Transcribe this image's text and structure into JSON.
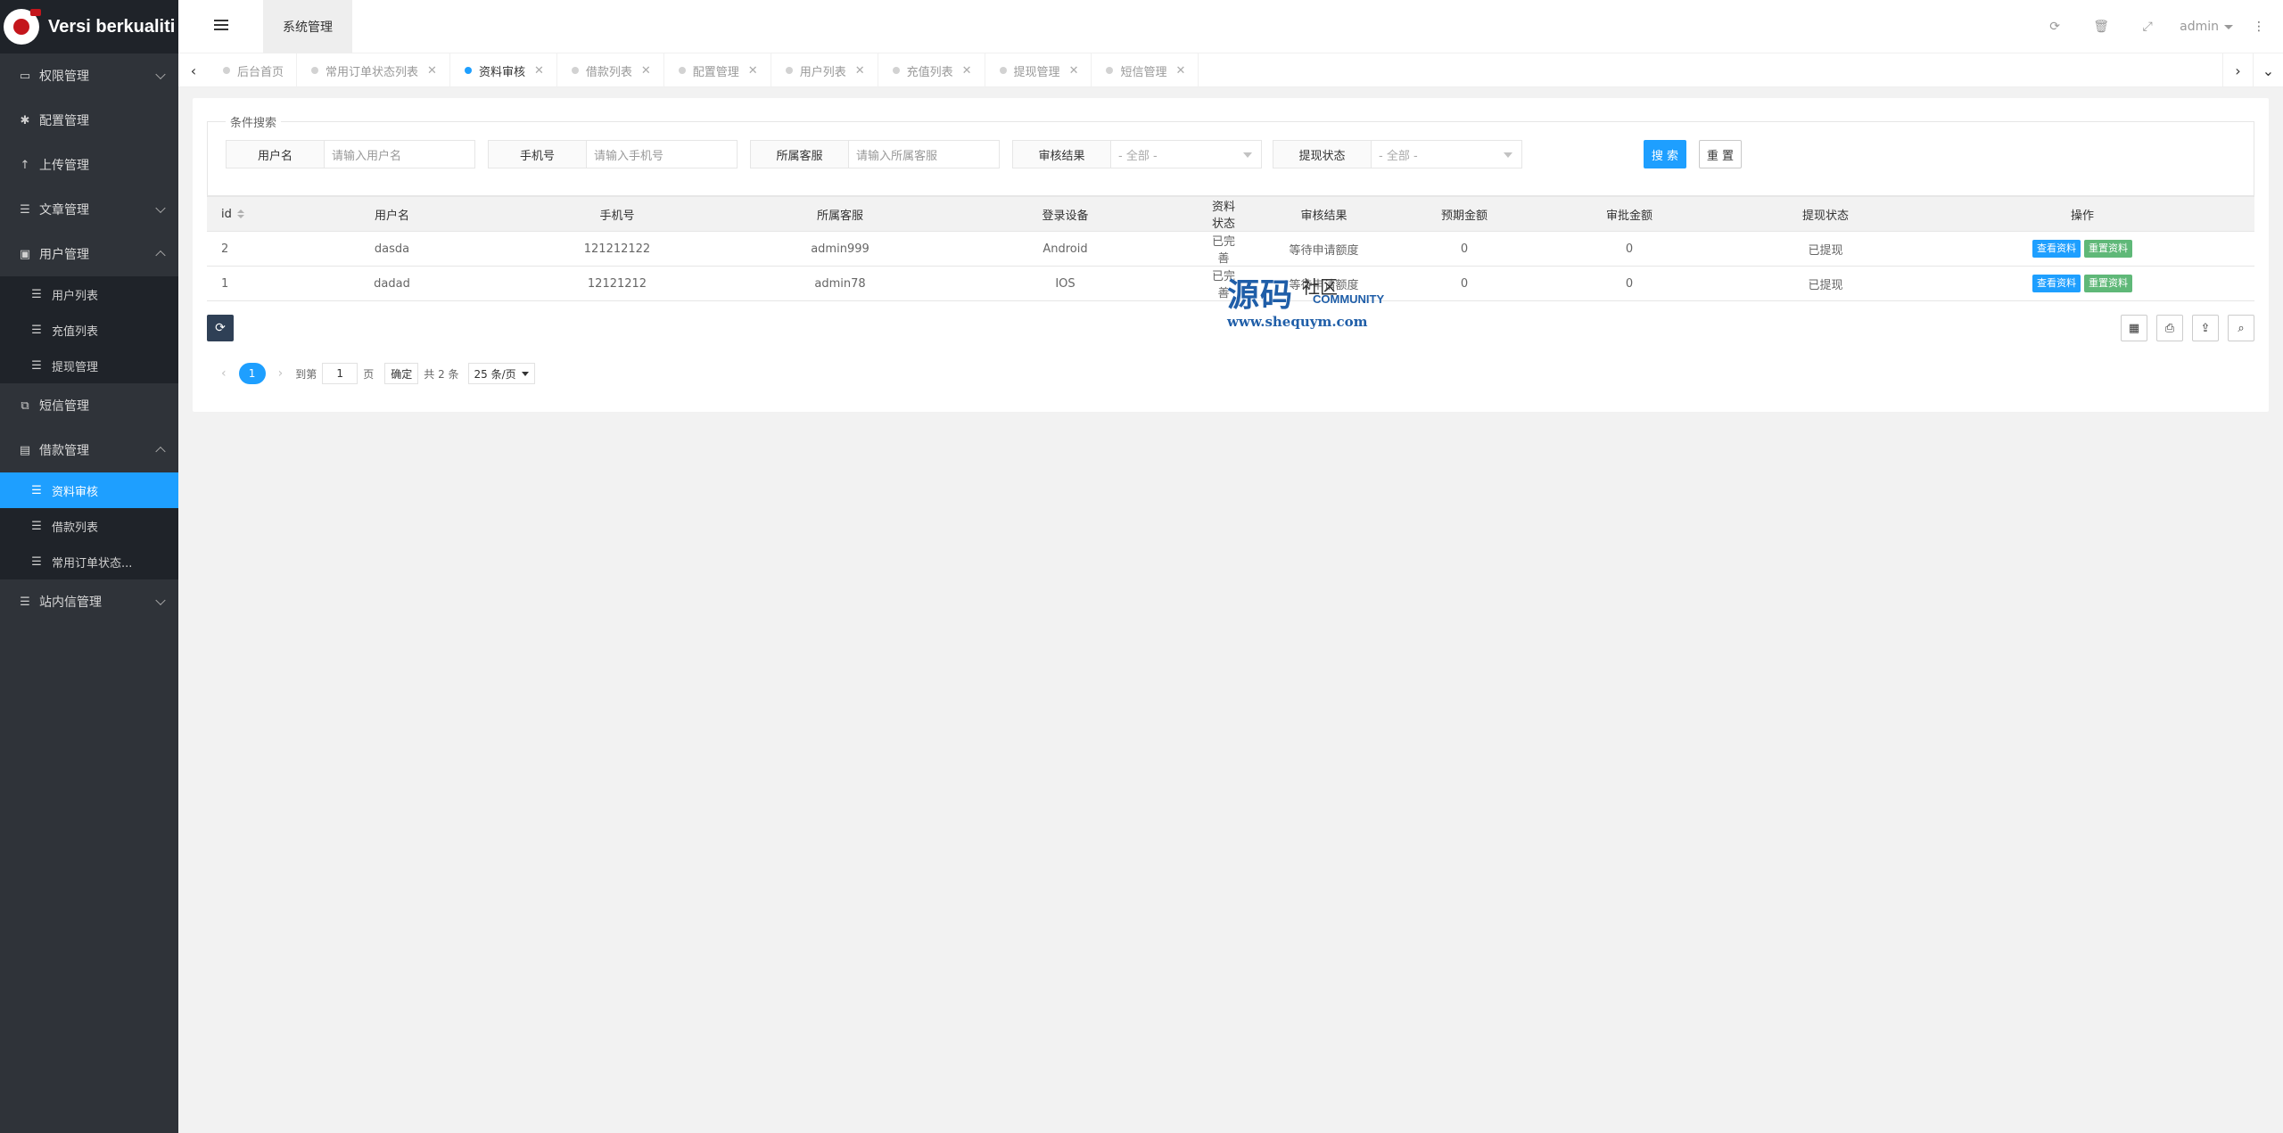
{
  "app": {
    "logo_text": "Versi berkualiti",
    "header_tab": "系统管理",
    "user": "admin"
  },
  "sidebar": {
    "items": [
      {
        "label": "权限管理",
        "icon": "laptop-icon",
        "caret": "down"
      },
      {
        "label": "配置管理",
        "icon": "gear-icon",
        "caret": ""
      },
      {
        "label": "上传管理",
        "icon": "upload-icon",
        "caret": ""
      },
      {
        "label": "文章管理",
        "icon": "list-icon",
        "caret": "down"
      },
      {
        "label": "用户管理",
        "icon": "user-icon",
        "caret": "up"
      },
      {
        "label": "短信管理",
        "icon": "copy-icon",
        "caret": ""
      },
      {
        "label": "借款管理",
        "icon": "money-icon",
        "caret": "up"
      },
      {
        "label": "站内信管理",
        "icon": "list-icon",
        "caret": "down"
      }
    ],
    "user_sub": [
      "用户列表",
      "充值列表",
      "提现管理"
    ],
    "loan_sub": [
      "资料审核",
      "借款列表",
      "常用订单状态..."
    ]
  },
  "tabs": [
    {
      "label": "后台首页",
      "active": false,
      "closable": false
    },
    {
      "label": "常用订单状态列表",
      "active": false,
      "closable": true
    },
    {
      "label": "资料审核",
      "active": true,
      "closable": true
    },
    {
      "label": "借款列表",
      "active": false,
      "closable": true
    },
    {
      "label": "配置管理",
      "active": false,
      "closable": true
    },
    {
      "label": "用户列表",
      "active": false,
      "closable": true
    },
    {
      "label": "充值列表",
      "active": false,
      "closable": true
    },
    {
      "label": "提现管理",
      "active": false,
      "closable": true
    },
    {
      "label": "短信管理",
      "active": false,
      "closable": true
    }
  ],
  "search": {
    "legend": "条件搜索",
    "username_label": "用户名",
    "username_placeholder": "请输入用户名",
    "phone_label": "手机号",
    "phone_placeholder": "请输入手机号",
    "agent_label": "所属客服",
    "agent_placeholder": "请输入所属客服",
    "audit_label": "审核结果",
    "audit_value": "- 全部 -",
    "withdraw_label": "提现状态",
    "withdraw_value": "- 全部 -",
    "search_btn": "搜 索",
    "reset_btn": "重 置"
  },
  "table": {
    "headers": [
      "id",
      "用户名",
      "手机号",
      "所属客服",
      "登录设备",
      "资料状态",
      "审核结果",
      "预期金额",
      "审批金额",
      "提现状态",
      "操作"
    ],
    "rows": [
      {
        "id": "2",
        "username": "dasda",
        "phone": "121212122",
        "agent": "admin999",
        "device": "Android",
        "info_status": "已完善",
        "audit": "等待申请额度",
        "expected": "0",
        "approved": "0",
        "withdraw": "已提现",
        "btn_view": "查看资料",
        "btn_reset": "重置资料"
      },
      {
        "id": "1",
        "username": "dadad",
        "phone": "12121212",
        "agent": "admin78",
        "device": "IOS",
        "info_status": "已完善",
        "audit": "等待申请额度",
        "expected": "0",
        "approved": "0",
        "withdraw": "已提现",
        "btn_view": "查看资料",
        "btn_reset": "重置资料"
      }
    ]
  },
  "pager": {
    "current": "1",
    "goto_label": "到第",
    "page_input": "1",
    "page_unit": "页",
    "confirm": "确定",
    "total": "共 2 条",
    "page_size": "25 条/页"
  },
  "watermark": {
    "cn": "源码",
    "cn2": "社区",
    "en": "COMMUNITY",
    "url": "www.shequym.com"
  },
  "colors": {
    "accent": "#1e9fff",
    "green": "#5fb878",
    "sidebar": "#2f3339"
  }
}
